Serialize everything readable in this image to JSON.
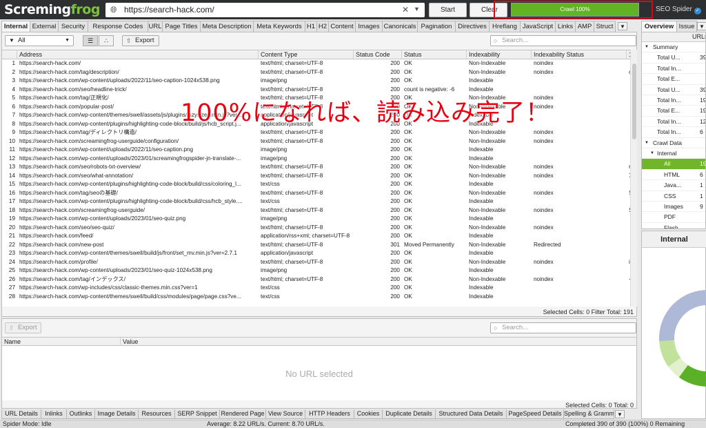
{
  "app": {
    "logo_pre": "Scre",
    "logo_mid": "ming",
    "logo_frog": "frog",
    "brand": "SEO Spider"
  },
  "toolbar": {
    "url": "https://search-hack.com/",
    "start_label": "Start",
    "clear_label": "Clear",
    "crawl_label": "Crawl 100%",
    "crawl_progress": 1.0
  },
  "tabs": [
    "Internal",
    "External",
    "Security",
    "Response Codes",
    "URL",
    "Page Titles",
    "Meta Description",
    "Meta Keywords",
    "H1",
    "H2",
    "Content",
    "Images",
    "Canonicals",
    "Pagination",
    "Directives",
    "Hreflang",
    "JavaScript",
    "Links",
    "AMP",
    "Struct"
  ],
  "filter": {
    "selected": "All",
    "export_label": "Export",
    "search_placeholder": "Search..."
  },
  "grid": {
    "columns": [
      "",
      "Address",
      "Content Type",
      "Status Code",
      "Status",
      "Indexability",
      "Indexability Status",
      "1"
    ],
    "rows": [
      [
        "1",
        "https://search-hack.com/",
        "text/html; charset=UTF-8",
        "200",
        "OK",
        "Non-Indexable",
        "noindex",
        ""
      ],
      [
        "2",
        "https://search-hack.com/tag/description/",
        "text/html; charset=UTF-8",
        "200",
        "OK",
        "Non-Indexable",
        "noindex",
        "c"
      ],
      [
        "3",
        "https://search-hack.com/wp-content/uploads/2022/11/seo-caption-1024x538.png",
        "image/png",
        "200",
        "OK",
        "Indexable",
        "",
        ""
      ],
      [
        "4",
        "https://search-hack.com/seo/headline-trick/",
        "text/html; charset=UTF-8",
        "200",
        "count is negative: -6",
        "Indexable",
        "",
        ""
      ],
      [
        "5",
        "https://search-hack.com/tag/正規化/",
        "text/html; charset=UTF-8",
        "200",
        "OK",
        "Non-Indexable",
        "noindex",
        ""
      ],
      [
        "6",
        "https://search-hack.com/popular-post/",
        "text/html; charset=UTF-8",
        "200",
        "OK",
        "Non-Indexable",
        "noindex",
        ""
      ],
      [
        "7",
        "https://search-hack.com/wp-content/themes/swell/assets/js/plugins/lazysizes.min.js?ver...",
        "application/javascript",
        "200",
        "OK",
        "Indexable",
        "",
        ""
      ],
      [
        "8",
        "https://search-hack.com/wp-content/plugins/highlighting-code-block/build/js/hcb_script.j...",
        "application/javascript",
        "200",
        "OK",
        "Indexable",
        "",
        ""
      ],
      [
        "9",
        "https://search-hack.com/tag/ディレクトリ構造/",
        "text/html; charset=UTF-8",
        "200",
        "OK",
        "Non-Indexable",
        "noindex",
        ""
      ],
      [
        "10",
        "https://search-hack.com/screamingfrog-userguide/configuration/",
        "text/html; charset=UTF-8",
        "200",
        "OK",
        "Non-Indexable",
        "noindex",
        ""
      ],
      [
        "11",
        "https://search-hack.com/wp-content/uploads/2022/11/seo-caption.png",
        "image/png",
        "200",
        "OK",
        "Indexable",
        "",
        ""
      ],
      [
        "12",
        "https://search-hack.com/wp-content/uploads/2023/01/screamingfrogspider-jn-translate-...",
        "image/png",
        "200",
        "OK",
        "Indexable",
        "",
        ""
      ],
      [
        "13",
        "https://search-hack.com/seo/robots-txt-overview/",
        "text/html; charset=UTF-8",
        "200",
        "OK",
        "Non-Indexable",
        "noindex",
        "r"
      ],
      [
        "14",
        "https://search-hack.com/seo/what-annotation/",
        "text/html; charset=UTF-8",
        "200",
        "OK",
        "Non-Indexable",
        "noindex",
        "7"
      ],
      [
        "15",
        "https://search-hack.com/wp-content/plugins/highlighting-code-block/build/css/coloring_l...",
        "text/css",
        "200",
        "OK",
        "Indexable",
        "",
        ""
      ],
      [
        "16",
        "https://search-hack.com/tag/seoの基礎/",
        "text/html; charset=UTF-8",
        "200",
        "OK",
        "Non-Indexable",
        "noindex",
        "S"
      ],
      [
        "17",
        "https://search-hack.com/wp-content/plugins/highlighting-code-block/build/css/hcb_style....",
        "text/css",
        "200",
        "OK",
        "Indexable",
        "",
        ""
      ],
      [
        "18",
        "https://search-hack.com/screamingfrog-userguide/",
        "text/html; charset=UTF-8",
        "200",
        "OK",
        "Non-Indexable",
        "noindex",
        "S"
      ],
      [
        "19",
        "https://search-hack.com/wp-content/uploads/2023/01/seo-quiz.png",
        "image/png",
        "200",
        "OK",
        "Indexable",
        "",
        ""
      ],
      [
        "20",
        "https://search-hack.com/seo/seo-quiz/",
        "text/html; charset=UTF-8",
        "200",
        "OK",
        "Non-Indexable",
        "noindex",
        ""
      ],
      [
        "21",
        "https://search-hack.com/feed/",
        "application/rss+xml; charset=UTF-8",
        "200",
        "OK",
        "Indexable",
        "",
        ""
      ],
      [
        "22",
        "https://search-hack.com/new-post",
        "text/html; charset=UTF-8",
        "301",
        "Moved Permanently",
        "Non-Indexable",
        "Redirected",
        ""
      ],
      [
        "23",
        "https://search-hack.com/wp-content/themes/swell/build/js/front/set_mv.min.js?ver=2.7.1",
        "application/javascript",
        "200",
        "OK",
        "Indexable",
        "",
        ""
      ],
      [
        "24",
        "https://search-hack.com/profile/",
        "text/html; charset=UTF-8",
        "200",
        "OK",
        "Non-Indexable",
        "noindex",
        "ii"
      ],
      [
        "25",
        "https://search-hack.com/wp-content/uploads/2023/01/seo-quiz-1024x538.png",
        "image/png",
        "200",
        "OK",
        "Indexable",
        "",
        ""
      ],
      [
        "26",
        "https://search-hack.com/tag/インデックス/",
        "text/html; charset=UTF-8",
        "200",
        "OK",
        "Non-Indexable",
        "noindex",
        "-"
      ],
      [
        "27",
        "https://search-hack.com/wp-includes/css/classic-themes.min.css?ver=1",
        "text/css",
        "200",
        "OK",
        "Indexable",
        "",
        ""
      ],
      [
        "28",
        "https://search-hack.com/wp-content/themes/swell/build/css/modules/page/page.css?ve...",
        "text/css",
        "200",
        "OK",
        "Indexable",
        "",
        ""
      ]
    ],
    "status": "Selected Cells:  0  Filter Total:  191"
  },
  "annotation": "100%になれば、読み込み完了！",
  "lower": {
    "export_label": "Export",
    "search_placeholder": "Search...",
    "columns": [
      "Name",
      "Value"
    ],
    "empty_text": "No URL selected",
    "status": "Selected Cells:  0  Total:  0"
  },
  "bottom_tabs": [
    "URL Details",
    "Inlinks",
    "Outlinks",
    "Image Details",
    "Resources",
    "SERP Snippet",
    "Rendered Page",
    "View Source",
    "HTTP Headers",
    "Cookies",
    "Duplicate Details",
    "Structured Data Details",
    "PageSpeed Details",
    "Spelling & Gramm"
  ],
  "statusbar": {
    "mode": "Spider Mode: Idle",
    "speed": "Average: 8.22 URL/s. Current: 8.70 URL/s.",
    "completed": "Completed 390 of 390 (100%) 0 Remaining"
  },
  "right": {
    "tabs": [
      "Overview",
      "Issue"
    ],
    "column": "URLs",
    "tree": [
      {
        "label": "Summary",
        "value": "",
        "level": 0,
        "toggle": "▼"
      },
      {
        "label": "Total U...",
        "value": "39",
        "level": 1,
        "toggle": ""
      },
      {
        "label": "Total In...",
        "value": "",
        "level": 1,
        "toggle": ""
      },
      {
        "label": "Total E...",
        "value": "",
        "level": 1,
        "toggle": ""
      },
      {
        "label": "Total U...",
        "value": "39",
        "level": 1,
        "toggle": ""
      },
      {
        "label": "Total In...",
        "value": "19",
        "level": 1,
        "toggle": ""
      },
      {
        "label": "Total E...",
        "value": "19",
        "level": 1,
        "toggle": ""
      },
      {
        "label": "Total In...",
        "value": "12",
        "level": 1,
        "toggle": ""
      },
      {
        "label": "Total In...",
        "value": "6",
        "level": 1,
        "toggle": ""
      },
      {
        "label": "Crawl Data",
        "value": "",
        "level": 0,
        "toggle": "▼"
      },
      {
        "label": "Internal",
        "value": "",
        "level": 1,
        "toggle": "▼"
      },
      {
        "label": "All",
        "value": "19",
        "level": 2,
        "toggle": "",
        "selected": true
      },
      {
        "label": "HTML",
        "value": "6",
        "level": 2,
        "toggle": ""
      },
      {
        "label": "Java...",
        "value": "1",
        "level": 2,
        "toggle": ""
      },
      {
        "label": "CSS",
        "value": "1",
        "level": 2,
        "toggle": ""
      },
      {
        "label": "Images",
        "value": "9",
        "level": 2,
        "toggle": ""
      },
      {
        "label": "PDF",
        "value": "",
        "level": 2,
        "toggle": ""
      },
      {
        "label": "Flash",
        "value": "",
        "level": 2,
        "toggle": ""
      }
    ],
    "lower_title": "Internal"
  },
  "colors": {
    "accent_green": "#63b223",
    "selected_green": "#71b62a",
    "annotation_red": "#e60012",
    "donut_slate": "#aeb9d7",
    "donut_green": "#5bb027",
    "donut_light": "#c2e29b",
    "donut_pale": "#e1f0cd"
  }
}
